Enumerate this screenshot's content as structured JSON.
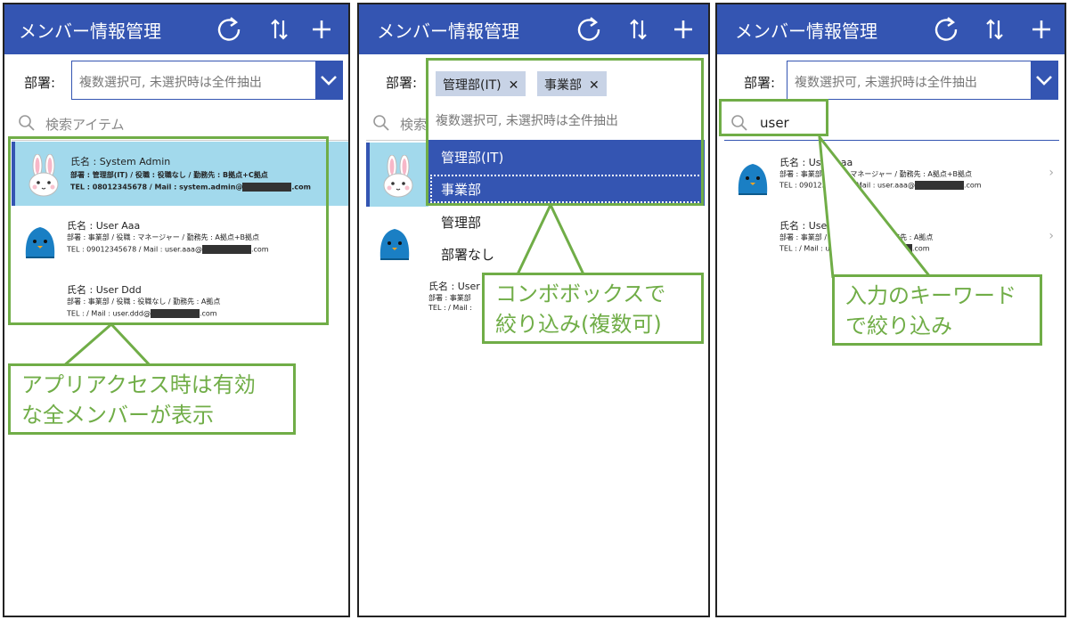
{
  "app": {
    "title": "メンバー情報管理",
    "icons": [
      "refresh-icon",
      "sort-icon",
      "add-icon"
    ],
    "accent": "#3455b2",
    "selected_bg": "#a2d9ec",
    "annotation_color": "#70ad47"
  },
  "panel1": {
    "dept_label": "部署:",
    "combo_placeholder": "複数選択可, 未選択時は全件抽出",
    "search_placeholder": "検索アイテム",
    "items": [
      {
        "name": "氏名 : System Admin",
        "line1": "部署 : 管理部(IT) / 役職 : 役職なし / 勤務先 : B拠点+C拠点",
        "line2a": "TEL : 08012345678 / Mail : system.admin@",
        "line2b": ".com"
      },
      {
        "name": "氏名 : User Aaa",
        "line1": "部署 : 事業部 / 役職 : マネージャー / 勤務先 : A拠点+B拠点",
        "line2a": "TEL : 09012345678 / Mail : user.aaa@",
        "line2b": ".com"
      },
      {
        "name": "氏名 : User Ddd",
        "line1": "部署 : 事業部 / 役職 : 役職なし / 勤務先 : A拠点",
        "line2a": "TEL : / Mail : user.ddd@",
        "line2b": ".com"
      }
    ],
    "callout": [
      "アプリアクセス時は有効",
      "な全メンバーが表示"
    ]
  },
  "panel2": {
    "dept_label": "部署:",
    "tags": [
      "管理部(IT)",
      "事業部"
    ],
    "tag_close": "✕",
    "combo_placeholder": "複数選択可, 未選択時は全件抽出",
    "search_placeholder_partial": "検索",
    "options": [
      "管理部(IT)",
      "事業部",
      "管理部",
      "部署なし"
    ],
    "partial_item": {
      "name": "氏名 : User D",
      "line1": "部署 : 事業部",
      "line2": "TEL : / Mail :"
    },
    "callout": [
      "コンボボックスで",
      "絞り込み(複数可)"
    ]
  },
  "panel3": {
    "dept_label": "部署:",
    "combo_placeholder": "複数選択可, 未選択時は全件抽出",
    "search_value": "user",
    "items": [
      {
        "name": "氏名 : User Aaa",
        "line1": "部署 : 事業部 / 役職 : マネージャー / 勤務先 : A拠点+B拠点",
        "line2a": "TEL : 09012345678 / Mail : user.aaa@",
        "line2b": ".com",
        "chevron": "›"
      },
      {
        "name": "氏名 : User Ddd",
        "line1": "部署 : 事業部 / 役職 : 役職なし / 勤務先 : A拠点",
        "line2a": "TEL : / Mail : user.ddd@",
        "line2b": ".com",
        "chevron": "›"
      }
    ],
    "callout": [
      "入力のキーワード",
      "で絞り込み"
    ]
  }
}
